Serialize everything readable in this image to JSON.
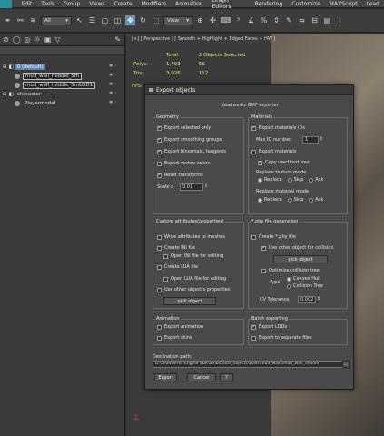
{
  "menu": [
    "Edit",
    "Tools",
    "Group",
    "Views",
    "Create",
    "Modifiers",
    "Animation",
    "Graph Editors",
    "Rendering",
    "Customize",
    "MAXScript",
    "Lead"
  ],
  "toolbar": {
    "selection_filter": "All",
    "view_dropdown": "View"
  },
  "scene": {
    "items": [
      {
        "label": "0 (default)",
        "selected": true
      },
      {
        "label": "mud_wall_middle_5m"
      },
      {
        "label": "mud_wall_middle_5mLOD1"
      },
      {
        "label": "character"
      },
      {
        "label": "Playermodel"
      }
    ]
  },
  "viewport": {
    "label": "[+] [ Perspective ] [ Smooth + Highlight + Edged Faces + HW ]",
    "stats": {
      "h_total": "Total",
      "h_sel": "2 Objects Selected",
      "polys_label": "Polys:",
      "polys_total": "1,793",
      "polys_sel": "56",
      "tris_label": "Tris:",
      "tris_total": "3,026",
      "tris_sel": "112"
    },
    "fps": "FPS:"
  },
  "dialog": {
    "title": "Export objects",
    "subtitle": "Leadwerks GMF exporter",
    "geometry": {
      "title": "Geometry",
      "export_selected": "Export selected only",
      "export_smoothing": "Export smoothing groups",
      "export_binormals": "Export binormals, tangents",
      "export_vertex_colors": "Export vertex colors",
      "reset_transforms": "Reset transforms",
      "scale_label": "Scale x",
      "scale_value": "0.01"
    },
    "materials": {
      "title": "Materials",
      "export_ids": "Export materials IDs",
      "max_id_label": "Max ID number:",
      "max_id_value": "1",
      "export_materials": "Export materials",
      "copy_textures": "Copy used textures",
      "replace_texture_mode": "Replace texture mode",
      "replace_material_mode": "Replace material mode",
      "opt_replace": "Replace",
      "opt_skip": "Skip",
      "opt_ask": "Ask"
    },
    "custom": {
      "title": "Custom attributes(properties)",
      "write_attrs": "Write attributes to meshes",
      "create_ini": "Create INI file",
      "open_ini": "Open INI file for editing",
      "create_lua": "Create LUA file",
      "open_lua": "Open LUA file for editing",
      "use_other": "Use other object's properties",
      "pick_object": "pick object"
    },
    "phy": {
      "title": "*.phy file generation",
      "create_phy": "Create *.phy file",
      "use_other_collision": "Use other object for collision",
      "pick_object": "pick object",
      "optimize": "Optimize collision tree",
      "type_label": "Type:",
      "convex_hull": "Convex Hull",
      "collision_tree": "Collision Tree",
      "cv_tolerance_label": "CV Tolerance:",
      "cv_tolerance_value": "0.002"
    },
    "animation": {
      "title": "Animation",
      "export_animation": "Export animation",
      "export_skins": "Export skins"
    },
    "batch": {
      "title": "Batch exporting",
      "export_lods": "Export LODs",
      "export_separate": "Export to separate files"
    },
    "destination_label": "Destination path:",
    "destination_value": "D:\\Leadwerks Engine SDK\\ambitious\\_objects\\walls\\mud_walls\\mud_wall_middle",
    "browse": "...",
    "export_btn": "Export",
    "cancel_btn": "Cancel",
    "help_btn": "?"
  }
}
